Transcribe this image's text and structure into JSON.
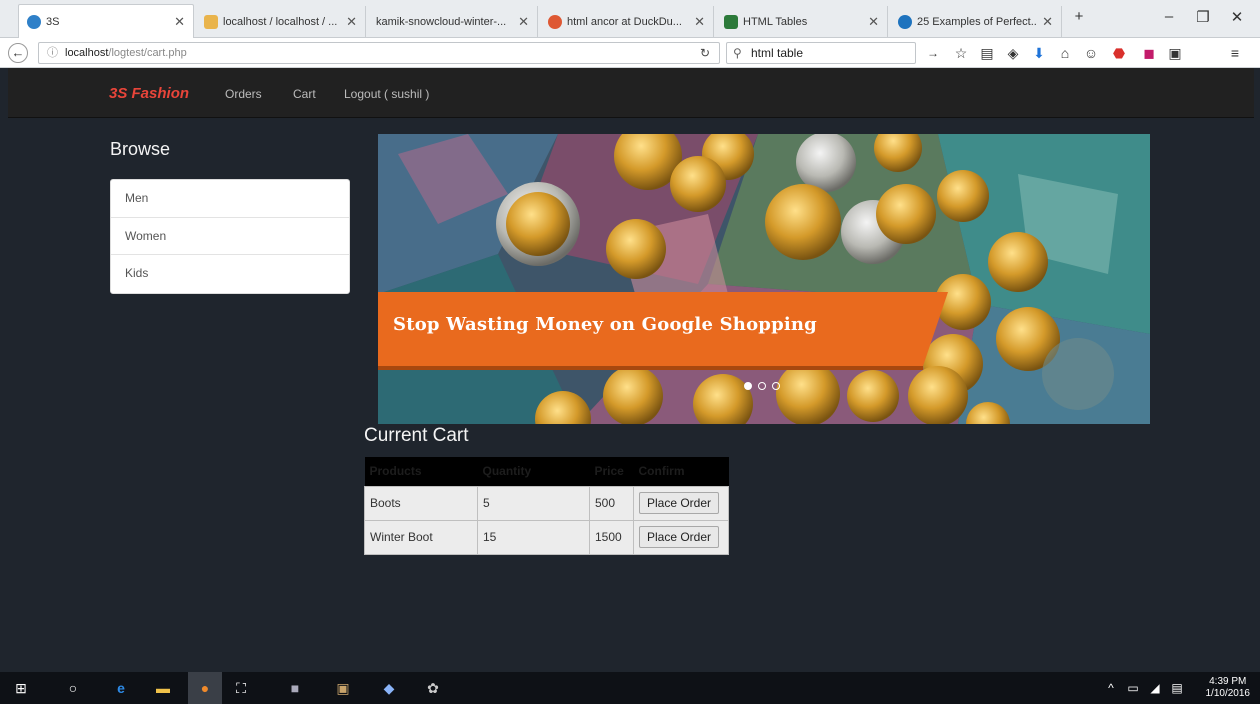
{
  "browser": {
    "tabs": [
      {
        "title": "3S",
        "color": "#2f80c8"
      },
      {
        "title": "localhost / localhost / ...",
        "color": "#e9b44c"
      },
      {
        "title": "kamik-snowcloud-winter-...",
        "color": "#888888"
      },
      {
        "title": "html ancor at DuckDu...",
        "color": "#de5833"
      },
      {
        "title": "HTML Tables",
        "color": "#2c7a3a"
      },
      {
        "title": "25 Examples of Perfect...",
        "color": "#1e73be"
      }
    ],
    "url_host": "localhost",
    "url_path": "/logtest/cart.php",
    "search_value": "html table"
  },
  "site": {
    "brand": "3S Fashion",
    "nav": [
      "Orders",
      "Cart",
      "Logout ( sushil )"
    ]
  },
  "browse": {
    "title": "Browse",
    "categories": [
      "Men",
      "Women",
      "Kids"
    ]
  },
  "banner": {
    "text": "Stop Wasting Money on Google Shopping",
    "slide_count": 3,
    "active_slide": 1,
    "ribbon_color": "#e96a1e"
  },
  "cart": {
    "title": "Current Cart",
    "columns": [
      "Products",
      "Quantity",
      "Price",
      "Confirm"
    ],
    "rows": [
      {
        "product": "Boots",
        "quantity": "5",
        "price": "500",
        "action": "Place Order"
      },
      {
        "product": "Winter Boot",
        "quantity": "15",
        "price": "1500",
        "action": "Place Order"
      }
    ]
  },
  "taskbar": {
    "time": "4:39 PM",
    "date": "1/10/2016"
  }
}
